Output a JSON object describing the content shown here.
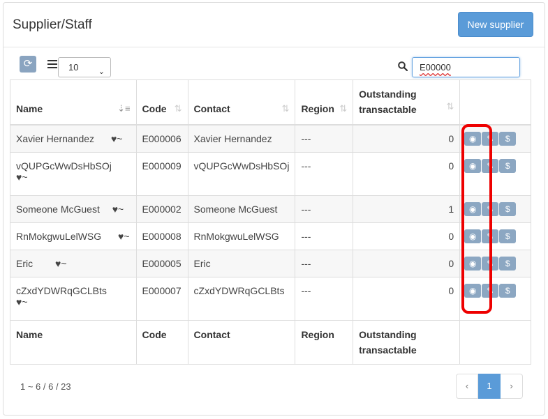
{
  "header": {
    "title": "Supplier/Staff",
    "new_button": "New supplier"
  },
  "toolbar": {
    "refresh_icon": "refresh-icon",
    "columns_icon": "list-icon",
    "page_size": "10",
    "search_icon": "search-icon",
    "search_value": "E00000"
  },
  "table": {
    "headers": [
      "Name",
      "Code",
      "Contact",
      "Region",
      "Outstanding transactable",
      ""
    ],
    "rows": [
      {
        "name": "Xavier Hernandez",
        "code": "E000006",
        "contact": "Xavier Hernandez",
        "region": "---",
        "outstanding": "0"
      },
      {
        "name": "vQUPGcWwDsHbSOj",
        "code": "E000009",
        "contact": "vQUPGcWwDsHbSOj",
        "region": "---",
        "outstanding": "0"
      },
      {
        "name": "Someone McGuest",
        "code": "E000002",
        "contact": "Someone McGuest",
        "region": "---",
        "outstanding": "1"
      },
      {
        "name": "RnMokgwuLelWSG",
        "code": "E000008",
        "contact": "RnMokgwuLelWSG",
        "region": "---",
        "outstanding": "0"
      },
      {
        "name": "Eric",
        "code": "E000005",
        "contact": "Eric",
        "region": "---",
        "outstanding": "0"
      },
      {
        "name": "cZxdYDWRqGCLBts",
        "code": "E000007",
        "contact": "cZxdYDWRqGCLBts",
        "region": "---",
        "outstanding": "0"
      }
    ],
    "footers": [
      "Name",
      "Code",
      "Contact",
      "Region",
      "Outstanding transactable",
      ""
    ],
    "row_icons": {
      "status": "heartbeat-icon",
      "view": "eye-icon",
      "edit": "edit-icon",
      "money": "dollar-icon"
    }
  },
  "pagination": {
    "info": "1 ~ 6 / 6 / 23",
    "prev": "‹",
    "current": "1",
    "next": "›"
  },
  "colors": {
    "accent": "#5a9bd8",
    "action_button": "#8ca7c2",
    "highlight": "#e00000"
  }
}
